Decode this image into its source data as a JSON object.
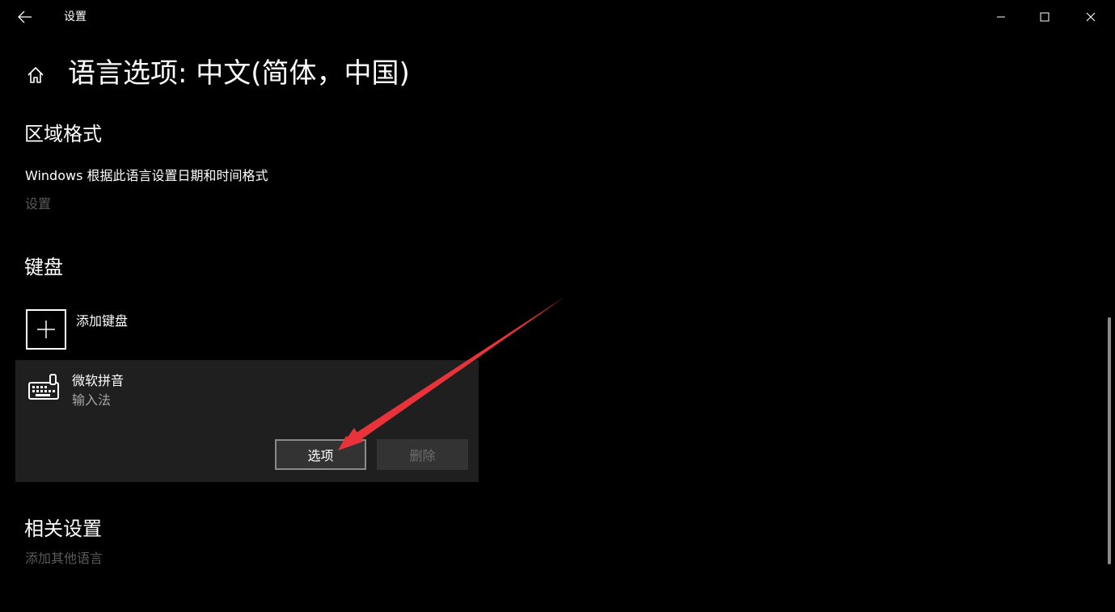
{
  "titlebar": {
    "app_title": "设置",
    "back_icon": "back-arrow-icon",
    "minimize_icon": "minimize-icon",
    "maximize_icon": "maximize-icon",
    "close_icon": "close-icon"
  },
  "header": {
    "home_icon": "home-icon",
    "title": "语言选项: 中文(简体，中国)"
  },
  "region_format": {
    "heading": "区域格式",
    "description": "Windows 根据此语言设置日期和时间格式",
    "settings_link": "设置"
  },
  "keyboard": {
    "heading": "键盘",
    "add_label": "添加键盘",
    "add_icon": "plus-icon",
    "ime": {
      "icon": "keyboard-icon",
      "name": "微软拼音",
      "type": "输入法",
      "options_label": "选项",
      "delete_label": "删除"
    }
  },
  "related": {
    "heading": "相关设置",
    "add_other_language": "添加其他语言"
  },
  "colors": {
    "background": "#000000",
    "card": "#1f1f1f",
    "disabled_text": "#5a5a5a",
    "annotation_arrow": "#e8333b"
  }
}
